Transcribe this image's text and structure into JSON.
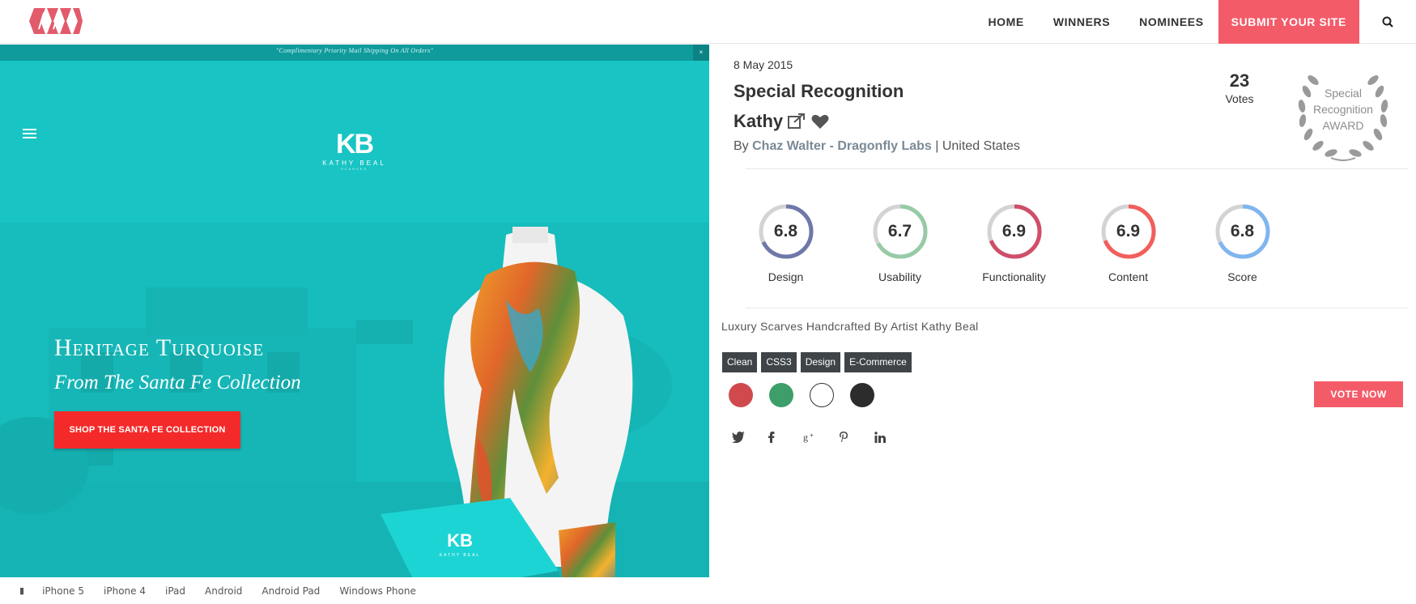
{
  "nav": {
    "items": [
      "HOME",
      "WINNERS",
      "NOMINEES"
    ],
    "submit": "SUBMIT YOUR SITE",
    "search_icon": "search-icon"
  },
  "site_shot": {
    "shipping_text": "\"Complimentary Priority Mail Shipping On All Orders\"",
    "close": "×",
    "brand_mark": "KB",
    "brand_name": "KATHY BEAL",
    "brand_sub": "SCARVES",
    "hero_title": "Heritage Turquoise",
    "hero_subtitle": "From The Santa Fe Collection",
    "hero_button": "SHOP THE SANTA FE COLLECTION",
    "box_mark": "KB",
    "box_name": "KATHY BEAL"
  },
  "devices": [
    "iPhone 5",
    "iPhone 4",
    "iPad",
    "Android",
    "Android Pad",
    "Windows Phone"
  ],
  "details": {
    "date": "8 May 2015",
    "award_title": "Special Recognition",
    "site_name": "Kathy",
    "by": "By",
    "author": "Chaz Walter - Dragonfly Labs",
    "country_sep": "|",
    "country": "United States",
    "votes_count": "23",
    "votes_label": "Votes",
    "award_badge": [
      "Special",
      "Recognition",
      "AWARD"
    ],
    "scores": [
      {
        "value": "6.8",
        "label": "Design",
        "fraction": 0.68,
        "color": "#6f78a8"
      },
      {
        "value": "6.7",
        "label": "Usability",
        "fraction": 0.67,
        "color": "#97cba6"
      },
      {
        "value": "6.9",
        "label": "Functionality",
        "fraction": 0.69,
        "color": "#cf4e69"
      },
      {
        "value": "6.9",
        "label": "Content",
        "fraction": 0.69,
        "color": "#f15f5c"
      },
      {
        "value": "6.8",
        "label": "Score",
        "fraction": 0.68,
        "color": "#7fb6ef"
      }
    ],
    "description": "Luxury Scarves Handcrafted By Artist Kathy Beal",
    "tags": [
      "Clean",
      "CSS3",
      "Design",
      "E-Commerce"
    ],
    "colors": [
      "#d04a4d",
      "#3d9e6a",
      "#ffffff",
      "#2c2c2c"
    ],
    "vote_button": "VOTE NOW",
    "social": [
      "twitter-icon",
      "facebook-icon",
      "google-plus-icon",
      "pinterest-icon",
      "linkedin-icon"
    ]
  }
}
